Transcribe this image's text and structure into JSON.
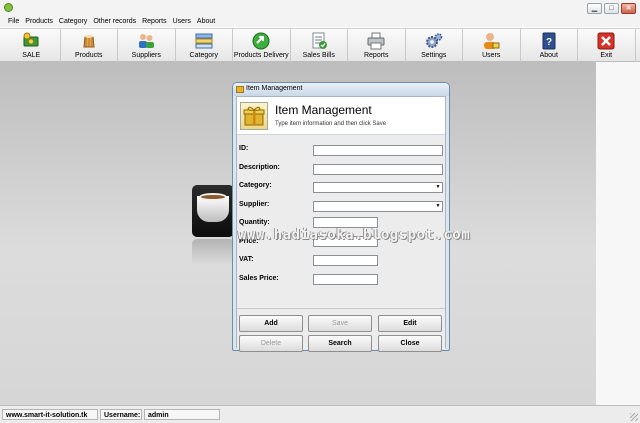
{
  "titlebar": {
    "minimize_glyph": "▁",
    "maximize_glyph": "□",
    "close_glyph": "✕"
  },
  "menu": [
    "File",
    "Products",
    "Category",
    "Other records",
    "Reports",
    "Users",
    "About"
  ],
  "toolbar": [
    {
      "label": "SALE",
      "icon": "money-icon"
    },
    {
      "label": "Products",
      "icon": "cake-icon"
    },
    {
      "label": "Suppliers",
      "icon": "people-icon"
    },
    {
      "label": "Category",
      "icon": "category-icon"
    },
    {
      "label": "Products Delivery",
      "icon": "delivery-arrow-icon"
    },
    {
      "label": "Sales Bills",
      "icon": "bill-icon"
    },
    {
      "label": "Reports",
      "icon": "printer-icon"
    },
    {
      "label": "Settings",
      "icon": "gears-icon"
    },
    {
      "label": "Users",
      "icon": "user-lock-icon"
    },
    {
      "label": "About",
      "icon": "help-book-icon"
    },
    {
      "label": "Exit",
      "icon": "exit-icon"
    }
  ],
  "watermark": "www.hadiasoka.blogspot.com",
  "dialog": {
    "title": "Item Management",
    "header_title": "Item Management",
    "header_subtitle": "Type item information and then click Save",
    "fields": {
      "id": {
        "label": "ID:",
        "value": ""
      },
      "description": {
        "label": "Description:",
        "value": ""
      },
      "category": {
        "label": "Category:",
        "value": ""
      },
      "supplier": {
        "label": "Supplier:",
        "value": ""
      },
      "quantity": {
        "label": "Quantity:",
        "value": ""
      },
      "price": {
        "label": "Price:",
        "value": ""
      },
      "vat": {
        "label": "VAT:",
        "value": ""
      },
      "sales_price": {
        "label": "Sales Price:",
        "value": ""
      }
    },
    "buttons": {
      "add": "Add",
      "save": "Save",
      "edit": "Edit",
      "delete": "Delete",
      "search": "Search",
      "close": "Close"
    }
  },
  "statusbar": {
    "website": "www.smart-it-solution.tk",
    "username_label": "Username:",
    "username_value": "admin"
  }
}
